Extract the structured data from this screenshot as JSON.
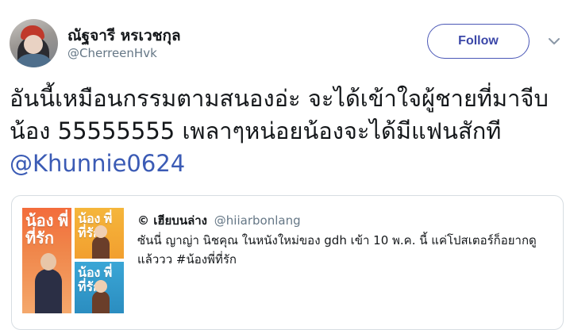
{
  "author": {
    "display_name": "ณัฐจารี หรเวชกุล",
    "handle": "@CherreenHvk"
  },
  "follow_button": {
    "label": "Follow"
  },
  "menu_icon": "chevron-down-icon",
  "tweet": {
    "text": "อันนี้เหมือนกรรมตามสนองอ่ะ จะได้เข้าใจผู้ชายที่มาจีบน้อง 55555555 เพลาๆหน่อยน้องจะได้มีแฟนสักที",
    "mention": "@Khunnie0624"
  },
  "quoted_tweet": {
    "display_name": "© เฮียบนล่าง",
    "handle": "@hiiarbonlang",
    "text": "ซันนี่ ญาญ่า นิชคุณ ในหนังใหม่ของ gdh เข้า 10 พ.ค. นี้ แค่โปสเตอร์ก็อยากดูแล้ววว #น้องพี่ที่รัก",
    "posters": [
      {
        "title": "น้อง พี่ ที่รัก"
      },
      {
        "title": "น้อง พี่ ที่รัก"
      },
      {
        "title": "น้อง พี่ ที่รัก"
      }
    ]
  },
  "colors": {
    "link": "#3b5bb5",
    "follow_border": "#4a57b6",
    "secondary_text": "#657786",
    "card_border": "#d7dde2"
  }
}
